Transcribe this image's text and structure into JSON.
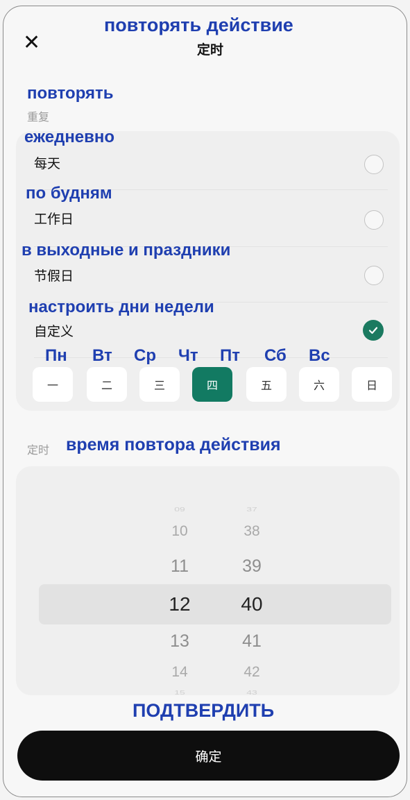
{
  "header": {
    "overlay": "повторять действие",
    "title": "定时",
    "close_glyph": "✕"
  },
  "repeat": {
    "overlay": "повторять",
    "label": "重复",
    "options": [
      {
        "overlay": "ежедневно",
        "label": "每天",
        "selected": false
      },
      {
        "overlay": "по будням",
        "label": "工作日",
        "selected": false
      },
      {
        "overlay": "в выходные и праздники",
        "label": "节假日",
        "selected": false
      },
      {
        "overlay": "настроить дни недели",
        "label": "自定义",
        "selected": true
      }
    ],
    "weekday_overlays": [
      "Пн",
      "Вт",
      "Ср",
      "Чт",
      "Пт",
      "Сб",
      "Вс"
    ],
    "weekdays": [
      "一",
      "二",
      "三",
      "四",
      "五",
      "六",
      "日"
    ],
    "selected_weekday_index": 3
  },
  "timing": {
    "label": "定时",
    "overlay": "время повтора действия",
    "hours": [
      "09",
      "10",
      "11",
      "12",
      "13",
      "14",
      "15"
    ],
    "minutes": [
      "37",
      "38",
      "39",
      "40",
      "41",
      "42",
      "43"
    ],
    "selected_hour": "12",
    "selected_minute": "40"
  },
  "footer": {
    "overlay": "ПОДТВЕРДИТЬ",
    "confirm_label": "确定"
  },
  "colors": {
    "accent": "#127a62",
    "overlay_text": "#1f3fb0",
    "confirm_bg": "#0e0e0e"
  }
}
